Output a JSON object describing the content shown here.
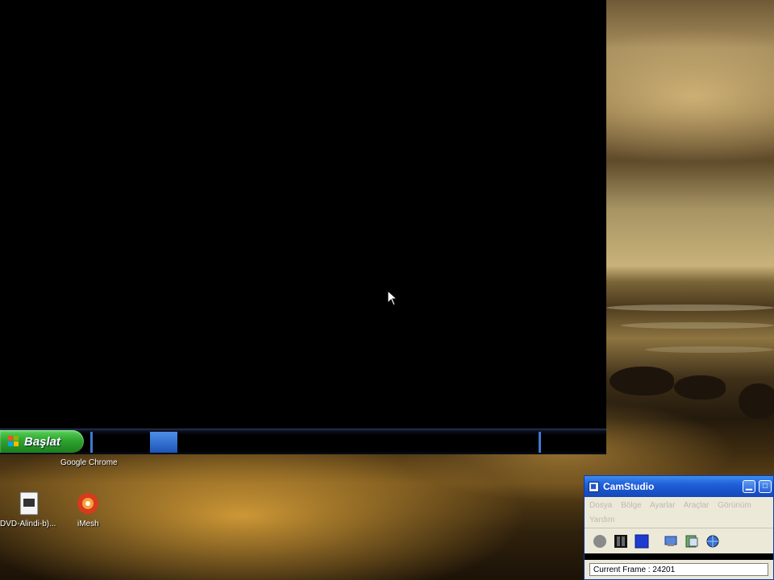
{
  "taskbar": {
    "start_label": "Başlat"
  },
  "desktop": {
    "chrome_label": "Google Chrome",
    "icons": [
      {
        "label": "DVD-Alindi-b)..."
      },
      {
        "label": "iMesh"
      }
    ]
  },
  "camstudio": {
    "title": "CamStudio",
    "menu": [
      "Dosya",
      "Bölge",
      "Ayarlar",
      "Araçlar",
      "Görünüm",
      "Yardım"
    ],
    "status": "Current Frame : 24201"
  },
  "colors": {
    "start_green": "#2fa52f",
    "xp_blue": "#1f5fd8",
    "window_bg": "#ece9d8"
  }
}
